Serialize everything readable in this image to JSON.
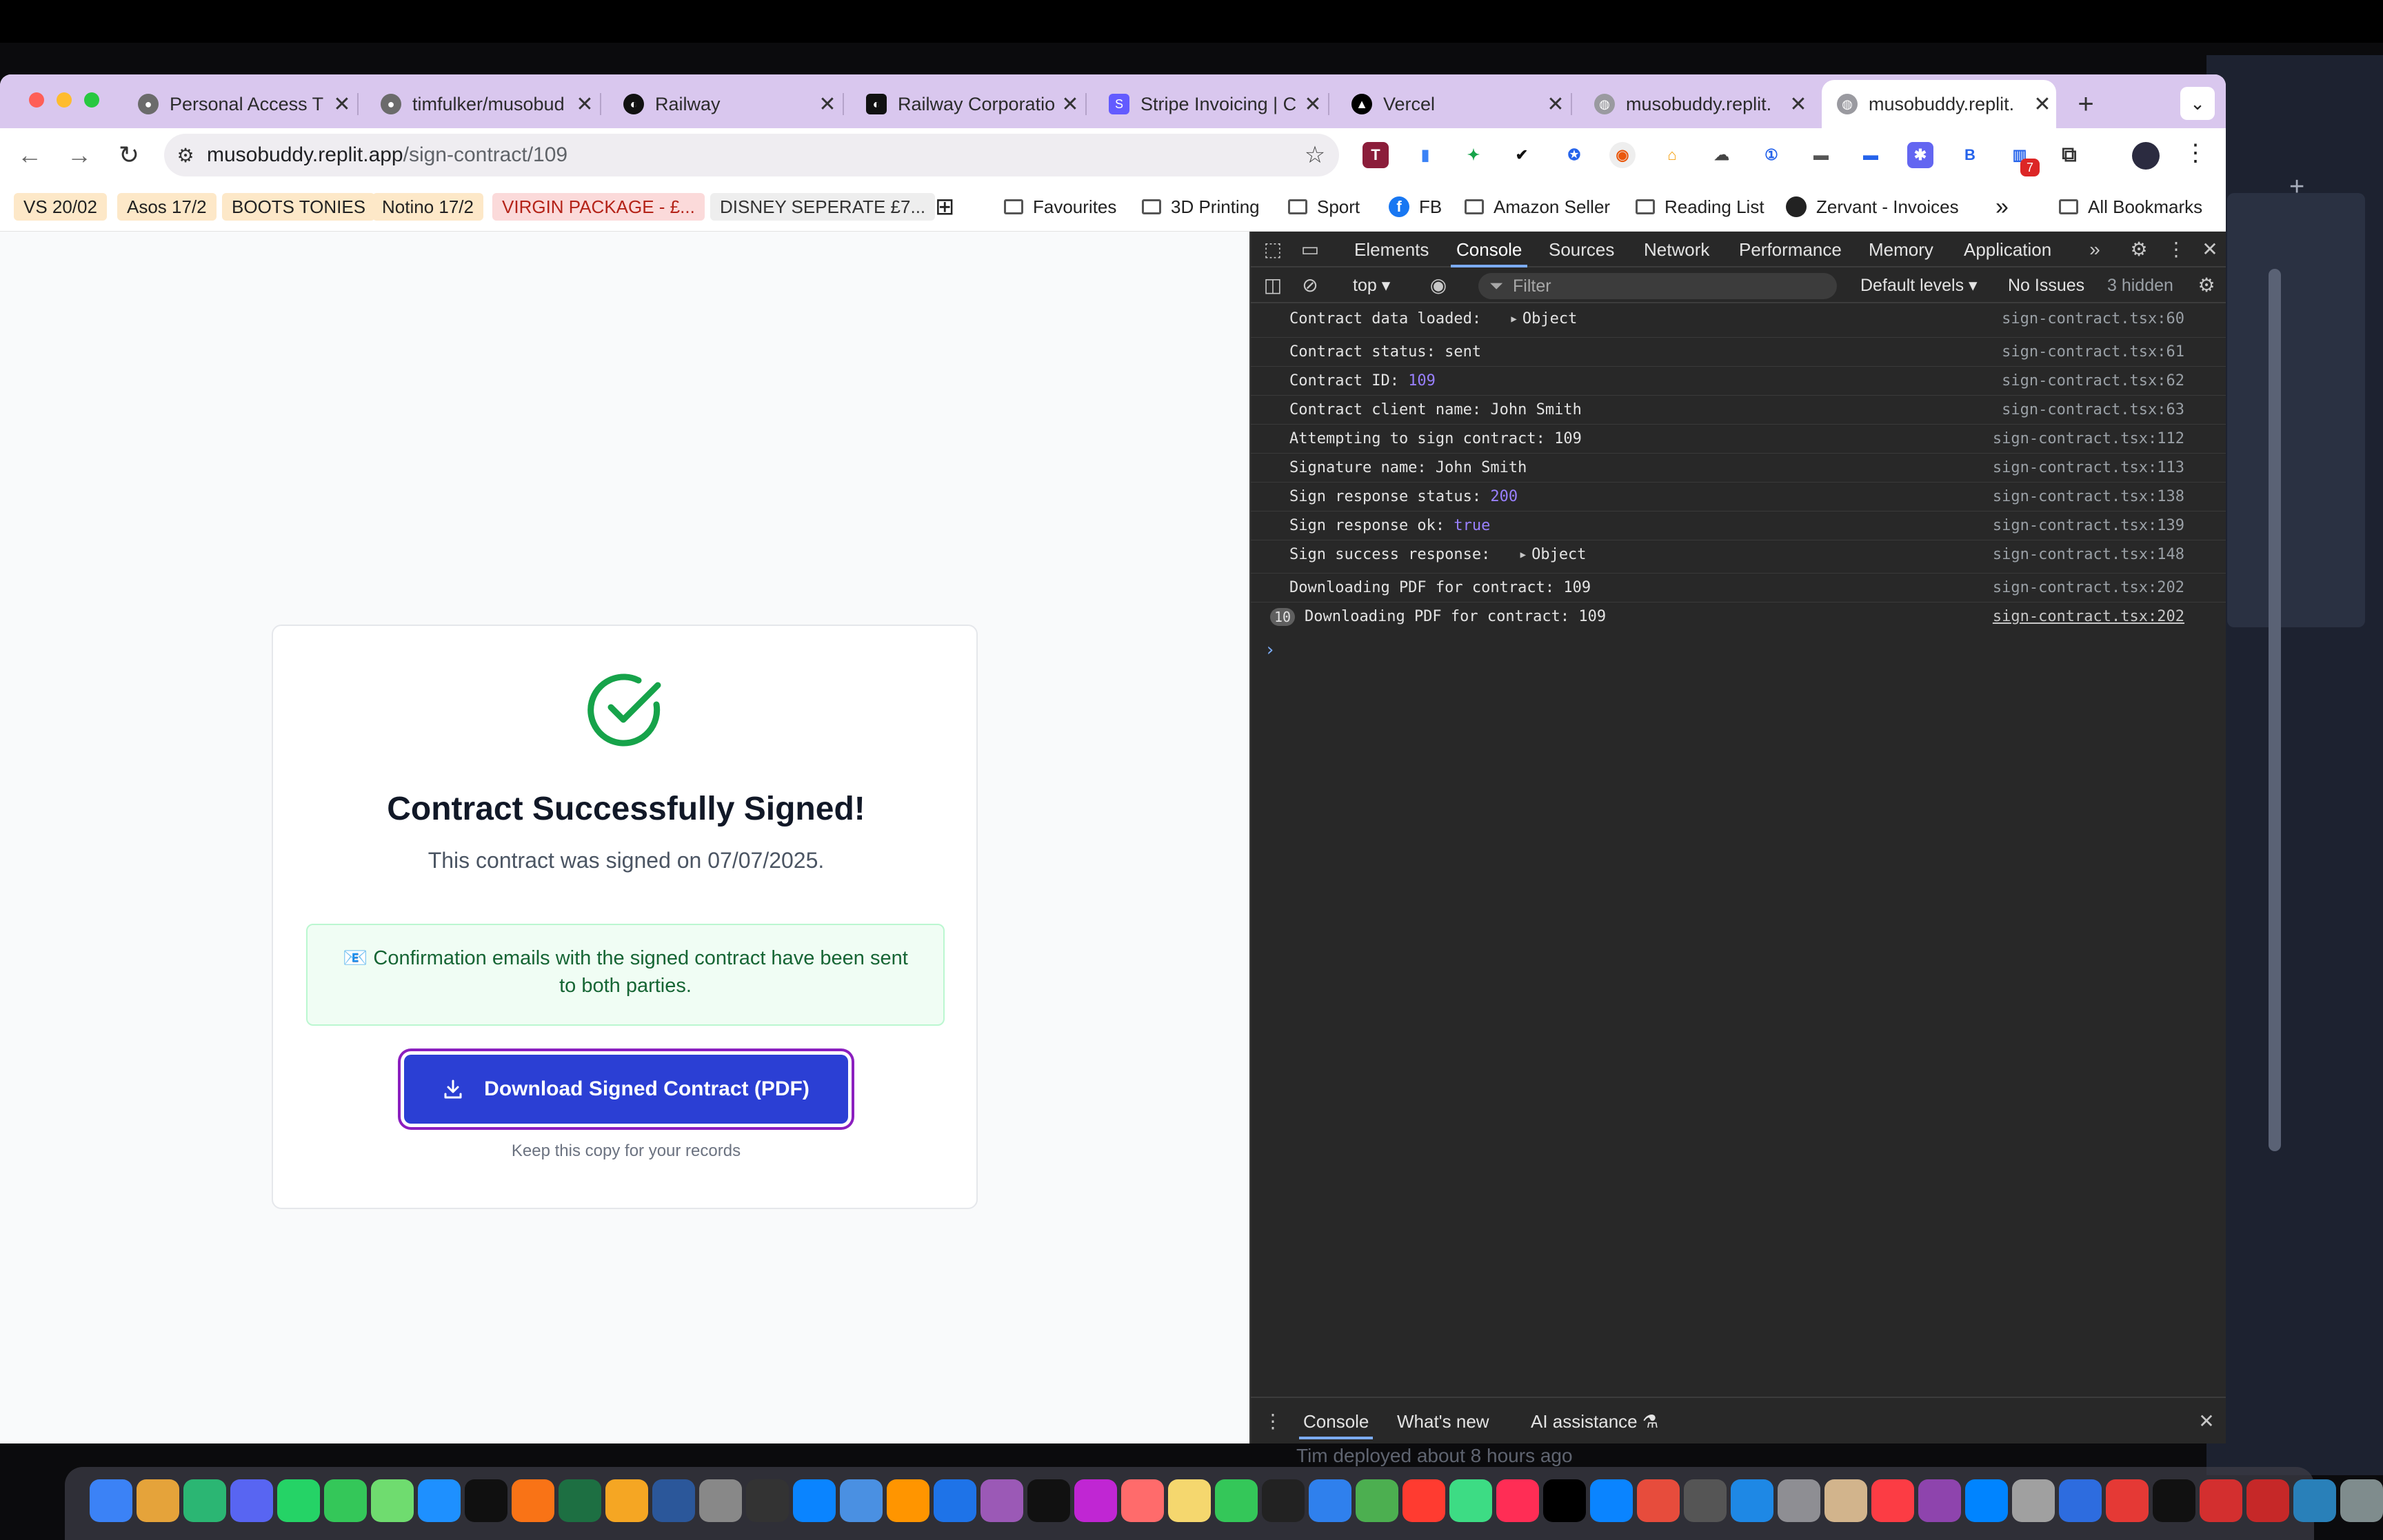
{
  "browser": {
    "tabs": [
      {
        "title": "Personal Access T",
        "icon": "github-icon"
      },
      {
        "title": "timfulker/musobud",
        "icon": "github-icon"
      },
      {
        "title": "Railway",
        "icon": "railway-icon"
      },
      {
        "title": "Railway Corporatio",
        "icon": "railway-icon"
      },
      {
        "title": "Stripe Invoicing | C",
        "icon": "stripe-icon"
      },
      {
        "title": "Vercel",
        "icon": "vercel-icon"
      },
      {
        "title": "musobuddy.replit.",
        "icon": "globe-icon"
      },
      {
        "title": "musobuddy.replit.",
        "icon": "globe-icon",
        "active": true
      }
    ],
    "address": {
      "host": "musobuddy.replit.app",
      "path": "/sign-contract/109"
    },
    "bookmarks": {
      "chips": [
        {
          "label": "VS 20/02",
          "bg": "#fde8c8",
          "fg": "#222222"
        },
        {
          "label": "Asos 17/2",
          "bg": "#fde8c8",
          "fg": "#222222"
        },
        {
          "label": "BOOTS TONIES",
          "bg": "#fde8c8",
          "fg": "#222222"
        },
        {
          "label": "Notino 17/2",
          "bg": "#fde8c8",
          "fg": "#222222"
        },
        {
          "label": "VIRGIN PACKAGE - £...",
          "bg": "#fbdada",
          "fg": "#b42318"
        },
        {
          "label": "DISNEY SEPERATE £7...",
          "bg": "#eeeeee",
          "fg": "#333333"
        }
      ],
      "folders": [
        "Favourites",
        "3D Printing",
        "Sport",
        "FB",
        "Amazon Seller",
        "Reading List",
        "Zervant - Invoices"
      ],
      "more": "»",
      "all": "All Bookmarks"
    },
    "extension_badge": "7"
  },
  "page": {
    "title": "Contract Successfully Signed!",
    "signed_on": "This contract was signed on 07/07/2025.",
    "notice": "Confirmation emails with the signed contract have been sent to both parties.",
    "notice_icon": "📧",
    "download_label": "Download Signed Contract (PDF)",
    "keep_copy": "Keep this copy for your records",
    "colors": {
      "success": "#16a34a",
      "button": "#2b3fd4",
      "focus_ring": "#8b1fbf"
    }
  },
  "devtools": {
    "tabs": [
      "Elements",
      "Console",
      "Sources",
      "Network",
      "Performance",
      "Memory",
      "Application"
    ],
    "active_tab": "Console",
    "context": "top",
    "filter_placeholder": "Filter",
    "levels": "Default levels",
    "issues": "No Issues",
    "hidden": "3 hidden",
    "logs": [
      {
        "text": "Contract data loaded: ",
        "object": "Object",
        "source": "sign-contract.tsx:60"
      },
      {
        "text": "Contract status: sent",
        "source": "sign-contract.tsx:61"
      },
      {
        "text": "Contract ID: ",
        "value": "109",
        "source": "sign-contract.tsx:62"
      },
      {
        "text": "Contract client name: John Smith",
        "source": "sign-contract.tsx:63"
      },
      {
        "text": "Attempting to sign contract: 109",
        "source": "sign-contract.tsx:112"
      },
      {
        "text": "Signature name: John Smith",
        "source": "sign-contract.tsx:113"
      },
      {
        "text": "Sign response status: ",
        "value": "200",
        "source": "sign-contract.tsx:138"
      },
      {
        "text": "Sign response ok: ",
        "value": "true",
        "source": "sign-contract.tsx:139"
      },
      {
        "text": "Sign success response: ",
        "object": "Object",
        "source": "sign-contract.tsx:148"
      },
      {
        "text": "Downloading PDF for contract: 109",
        "source": "sign-contract.tsx:202"
      },
      {
        "text": "Downloading PDF for contract: 109",
        "source": "sign-contract.tsx:202",
        "count": "10"
      }
    ],
    "prompt": "›",
    "drawer_tabs": [
      "Console",
      "What's new",
      "AI assistance"
    ]
  },
  "dock": {
    "app_colors": [
      "#3b82f6",
      "#e5a33a",
      "#2bb673",
      "#5865f2",
      "#25d366",
      "#34c759",
      "#6fdc6f",
      "#1e90ff",
      "#101010",
      "#f97316",
      "#1d6f42",
      "#f5a623",
      "#2b579a",
      "#888888",
      "#333333",
      "#0a84ff",
      "#4a90e2",
      "#ff9500",
      "#1e73e8",
      "#9b59b6",
      "#111111",
      "#c026d3",
      "#ff6b6b",
      "#f5d76e",
      "#34c759",
      "#222222",
      "#2f80ed",
      "#4caf50",
      "#ff3b30",
      "#3ddc84",
      "#ff2d55",
      "#000000",
      "#0a84ff",
      "#e74c3c",
      "#555555",
      "#1e88e5",
      "#8e8e93",
      "#d2b48c",
      "#fc3c44",
      "#8e44ad",
      "#0084ff",
      "#a0a0a0",
      "#2d6cdf",
      "#e53935",
      "#111111",
      "#d32f2f",
      "#c62828",
      "#2980b9",
      "#7f8c8d",
      "#95a5a6"
    ]
  },
  "background": {
    "deploy_text": "Tim deployed about 8 hours ago"
  }
}
